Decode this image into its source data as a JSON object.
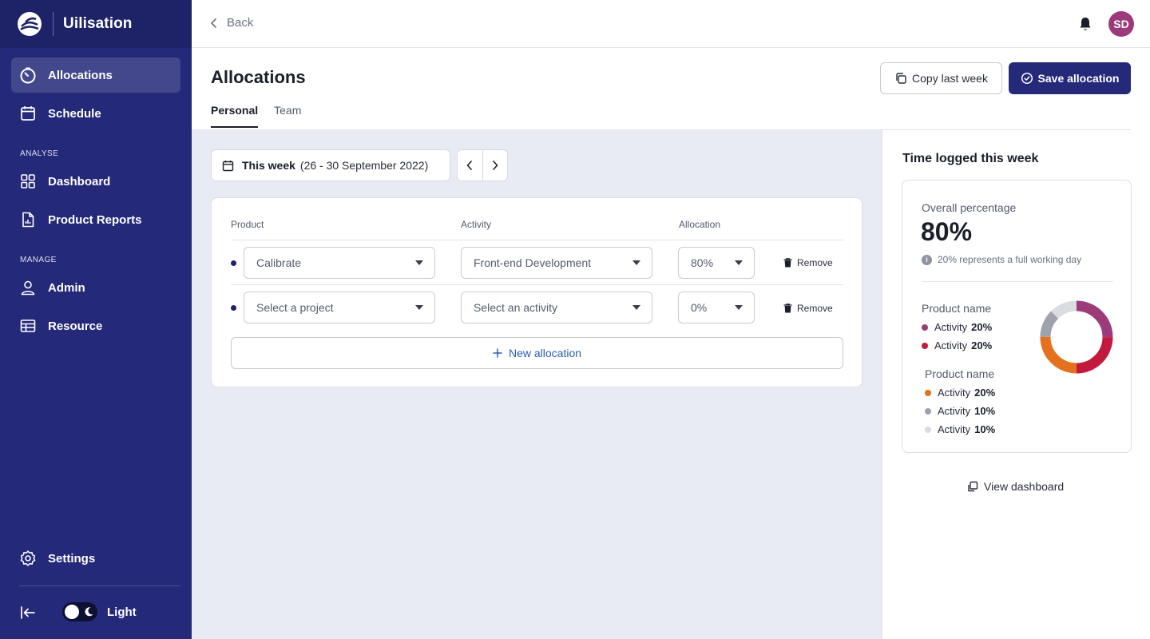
{
  "app": {
    "name": "Uilisation"
  },
  "sidebar": {
    "items": [
      {
        "label": "Allocations",
        "icon": "timer-icon",
        "active": true
      },
      {
        "label": "Schedule",
        "icon": "calendar-icon"
      },
      {
        "label": "Dashboard",
        "icon": "grid-icon"
      },
      {
        "label": "Product Reports",
        "icon": "report-icon"
      },
      {
        "label": "Admin",
        "icon": "user-icon"
      },
      {
        "label": "Resource",
        "icon": "table-icon"
      },
      {
        "label": "Settings",
        "icon": "gear-icon"
      }
    ],
    "sections": {
      "analyse": "ANALYSE",
      "manage": "MANAGE"
    },
    "theme_label": "Light"
  },
  "topbar": {
    "back_label": "Back",
    "avatar_initials": "SD",
    "avatar_color": "#9d3a7a"
  },
  "header": {
    "title": "Allocations",
    "copy_label": "Copy last week",
    "save_label": "Save allocation",
    "tabs": [
      {
        "label": "Personal",
        "active": true
      },
      {
        "label": "Team"
      }
    ]
  },
  "week": {
    "label": "This week",
    "range": "(26 - 30 September 2022)"
  },
  "allocations": {
    "columns": {
      "product": "Product",
      "activity": "Activity",
      "allocation": "Allocation"
    },
    "rows": [
      {
        "product": "Calibrate",
        "activity": "Front-end Development",
        "allocation": "80%",
        "remove": "Remove"
      },
      {
        "product": "Select a project",
        "activity": "Select an activity",
        "allocation": "0%",
        "remove": "Remove"
      }
    ],
    "new_label": "New allocation"
  },
  "summary": {
    "title": "Time logged this week",
    "overall_label": "Overall percentage",
    "overall_value": "80%",
    "note": "20% represents a full working day",
    "groups": [
      {
        "name": "Product name",
        "items": [
          {
            "label": "Activity",
            "pct": "20%",
            "color": "#9d3a7a"
          },
          {
            "label": "Activity",
            "pct": "20%",
            "color": "#c2193c"
          }
        ]
      },
      {
        "name": "Product name",
        "items": [
          {
            "label": "Activity",
            "pct": "20%",
            "color": "#e3711d"
          },
          {
            "label": "Activity",
            "pct": "10%",
            "color": "#9ea2ae"
          },
          {
            "label": "Activity",
            "pct": "10%",
            "color": "#dadce2"
          }
        ]
      }
    ],
    "view_dashboard": "View dashboard"
  },
  "chart_data": {
    "type": "pie",
    "categories": [
      "Activity",
      "Activity",
      "Activity",
      "Activity",
      "Activity"
    ],
    "values": [
      20,
      20,
      20,
      10,
      10
    ],
    "colors": [
      "#9d3a7a",
      "#c2193c",
      "#e3711d",
      "#9ea2ae",
      "#dadce2"
    ]
  }
}
